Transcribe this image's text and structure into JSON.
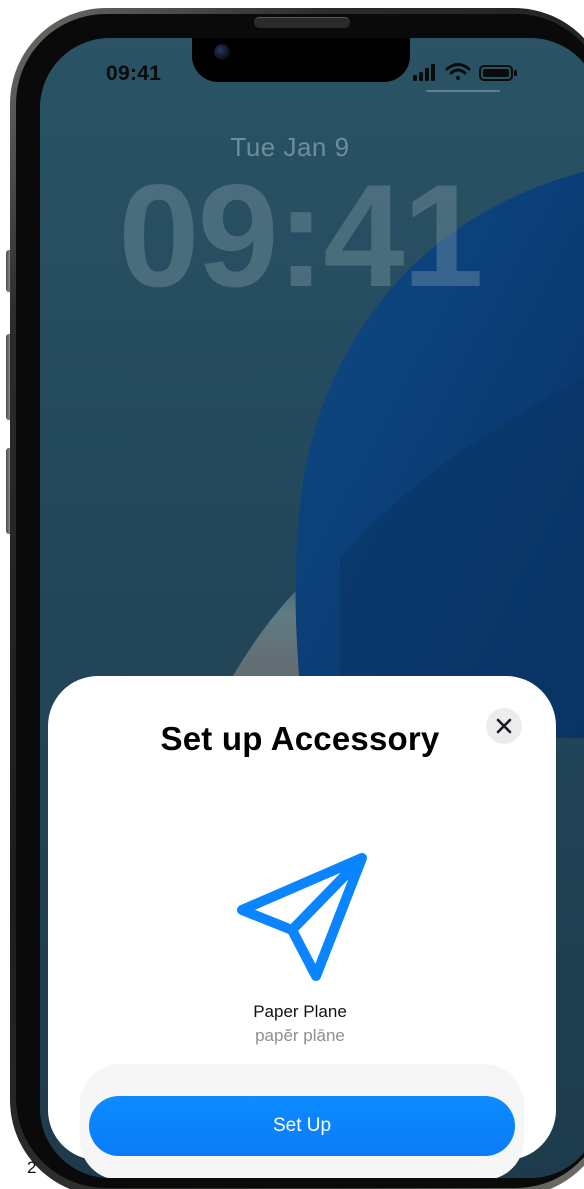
{
  "status_bar": {
    "time": "09:41",
    "icons": [
      "cellular-signal-icon",
      "wifi-icon",
      "battery-icon"
    ]
  },
  "lock_screen": {
    "date": "Tue Jan 9",
    "time": "09:41"
  },
  "sheet": {
    "title": "Set up Accessory",
    "close_icon": "close-icon",
    "accessory_icon": "paper-plane-icon",
    "accessory_name": "Paper Plane",
    "accessory_id": "papĕr plāne",
    "primary_button": "Set Up"
  },
  "page_number": "2",
  "colors": {
    "accent": "#0A84FF",
    "wallpaper_dark": "#1F3C4E",
    "wallpaper_blue": "#0B3C73",
    "sheet_background": "#FFFFFF",
    "close_button_background": "#ECECEF"
  }
}
